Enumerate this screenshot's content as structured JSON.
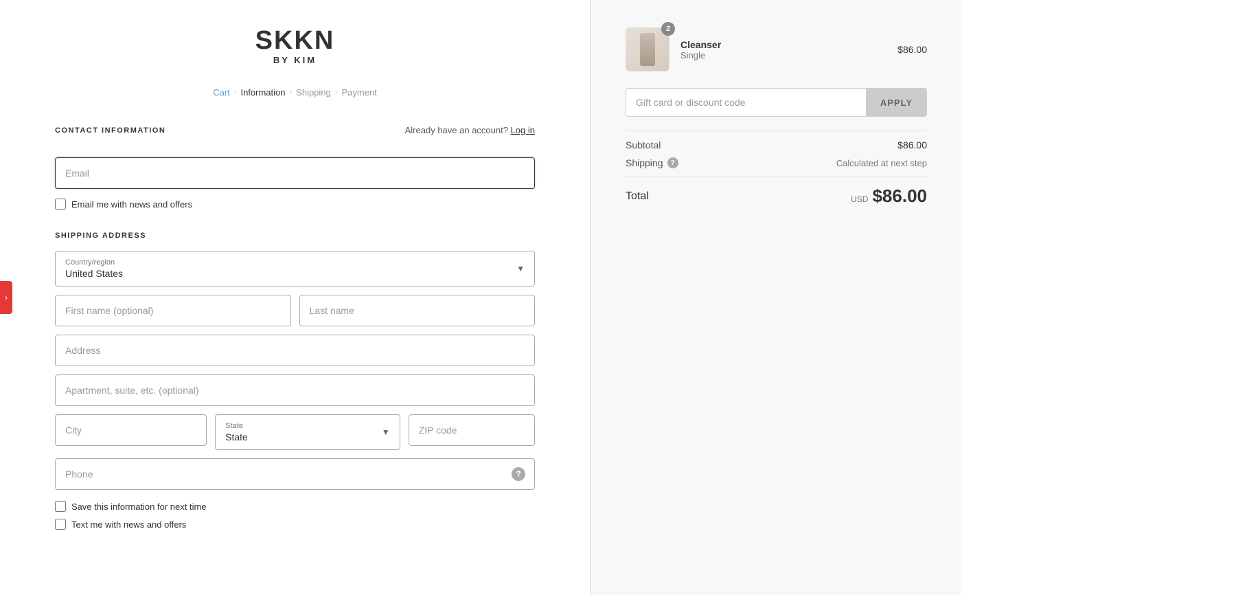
{
  "logo": {
    "main": "SKKN",
    "sub": "BY KIM"
  },
  "breadcrumb": {
    "cart": "Cart",
    "information": "Information",
    "shipping": "Shipping",
    "payment": "Payment"
  },
  "contact": {
    "title": "CONTACT INFORMATION",
    "already_account": "Already have an account?",
    "log_in": "Log in",
    "email_placeholder": "Email",
    "email_news_label": "Email me with news and offers"
  },
  "shipping": {
    "title": "SHIPPING ADDRESS",
    "country_label": "Country/region",
    "country_value": "United States",
    "first_name_placeholder": "First name (optional)",
    "last_name_placeholder": "Last name",
    "address_placeholder": "Address",
    "apartment_placeholder": "Apartment, suite, etc. (optional)",
    "city_placeholder": "City",
    "state_label": "State",
    "state_value": "State",
    "zip_placeholder": "ZIP code",
    "phone_placeholder": "Phone",
    "save_info_label": "Save this information for next time",
    "text_news_label": "Text me with news and offers"
  },
  "order": {
    "product_name": "Cleanser",
    "product_variant": "Single",
    "product_price": "$86.00",
    "badge_count": "2"
  },
  "discount": {
    "placeholder": "Gift card or discount code",
    "apply_label": "APPLY"
  },
  "summary": {
    "subtotal_label": "Subtotal",
    "subtotal_value": "$86.00",
    "shipping_label": "Shipping",
    "shipping_value": "Calculated at next step",
    "total_label": "Total",
    "total_currency": "USD",
    "total_amount": "$86.00"
  }
}
